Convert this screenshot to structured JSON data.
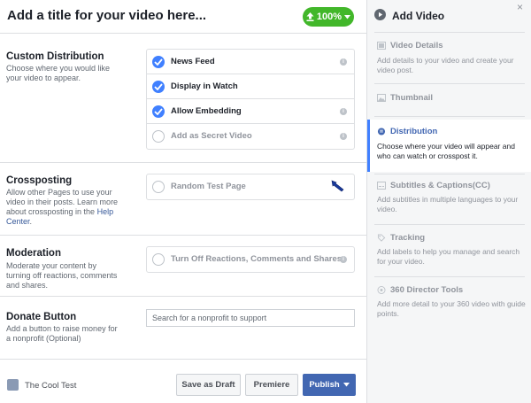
{
  "header": {
    "title": "Add a title for your video here...",
    "progress": "100%",
    "progress_color": "#42b72a"
  },
  "custom_distribution": {
    "title": "Custom Distribution",
    "description": "Choose where you would like your video to appear.",
    "options": [
      {
        "label": "News Feed",
        "checked": true,
        "info": true
      },
      {
        "label": "Display in Watch",
        "checked": true,
        "info": false
      },
      {
        "label": "Allow Embedding",
        "checked": true,
        "info": true
      },
      {
        "label": "Add as Secret Video",
        "checked": false,
        "info": true
      }
    ]
  },
  "crossposting": {
    "title": "Crossposting",
    "description": "Allow other Pages to use your video in their posts. Learn more about crossposting in the",
    "help_link": "Help Center",
    "period": ".",
    "option": "Random Test Page"
  },
  "moderation": {
    "title": "Moderation",
    "description": "Moderate your content by turning off reactions, comments and shares.",
    "option": "Turn Off Reactions, Comments and Shares"
  },
  "donate": {
    "title": "Donate Button",
    "description": "Add a button to raise money for a nonprofit (Optional)",
    "placeholder": "Search for a nonprofit to support"
  },
  "footer": {
    "page_name": "The Cool Test",
    "save_draft": "Save as Draft",
    "premiere": "Premiere",
    "publish": "Publish"
  },
  "sidebar": {
    "title": "Add Video",
    "close": "×",
    "accent": "#4080ff",
    "steps": [
      {
        "label": "Video Details",
        "description": "Add details to your video and create your video post.",
        "icon": "film-icon",
        "active": false
      },
      {
        "label": "Thumbnail",
        "description": "",
        "icon": "image-icon",
        "active": false
      },
      {
        "label": "Distribution",
        "description": "Choose where your video will appear and who can watch or crosspost it.",
        "icon": "distribution-icon",
        "active": true
      },
      {
        "label": "Subtitles & Captions(CC)",
        "description": "Add subtitles in multiple languages to your video.",
        "icon": "captions-icon",
        "active": false
      },
      {
        "label": "Tracking",
        "description": "Add labels to help you manage and search for your video.",
        "icon": "tag-icon",
        "active": false
      },
      {
        "label": "360 Director Tools",
        "description": "Add more detail to your 360 video with guide points.",
        "icon": "director-icon",
        "active": false
      }
    ]
  }
}
